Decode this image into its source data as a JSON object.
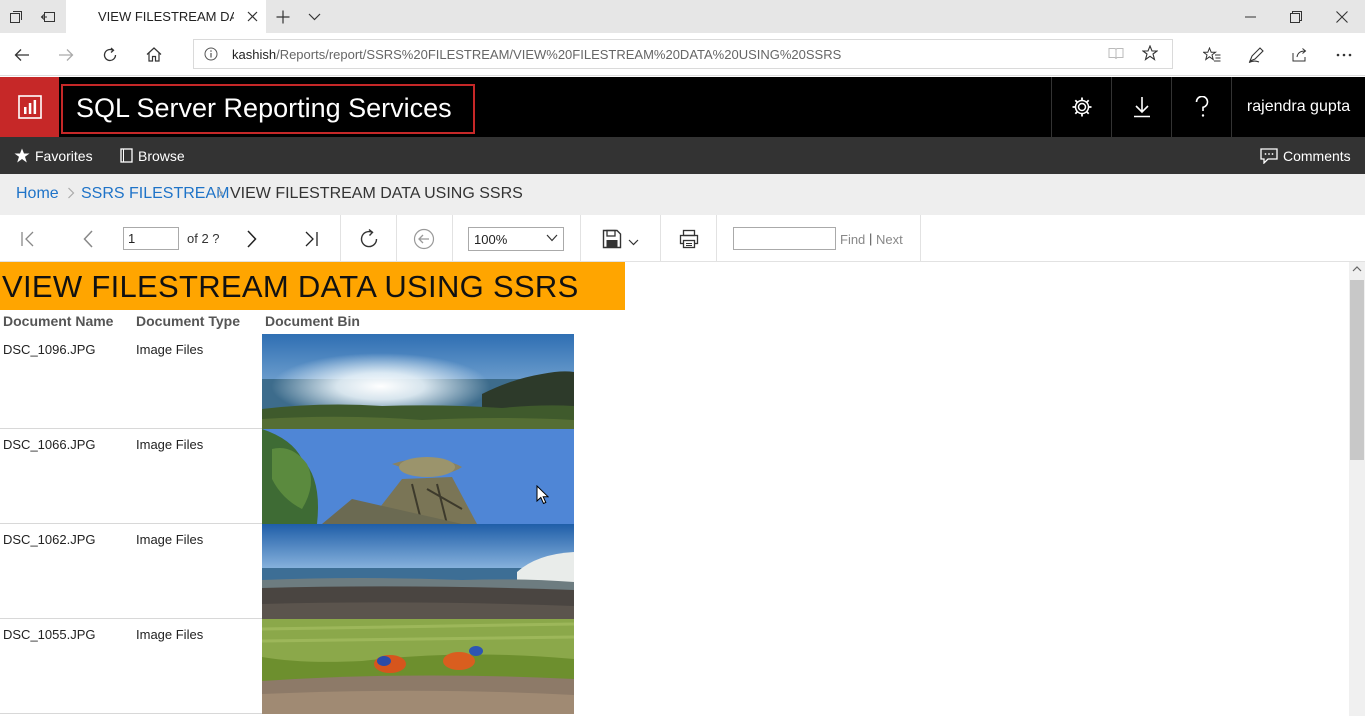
{
  "browser": {
    "tab_title": "VIEW FILESTREAM DATA",
    "url_host": "kashish",
    "url_path": "/Reports/report/SSRS%20FILESTREAM/VIEW%20FILESTREAM%20DATA%20USING%20SSRS"
  },
  "header": {
    "app_title": "SQL Server Reporting Services",
    "user": "rajendra gupta"
  },
  "subnav": {
    "favorites": "Favorites",
    "browse": "Browse",
    "comments": "Comments"
  },
  "breadcrumb": {
    "home": "Home",
    "folder": "SSRS FILESTREAM",
    "current": "VIEW FILESTREAM DATA USING SSRS"
  },
  "toolbar": {
    "page_value": "1",
    "of_pages": "of 2 ?",
    "zoom": "100%",
    "find_label": "Find",
    "find_sep": "|",
    "next_label": "Next"
  },
  "report": {
    "title": "VIEW FILESTREAM DATA USING SSRS",
    "columns": [
      "Document Name",
      "Document Type",
      "Document Bin"
    ],
    "rows": [
      {
        "name": "DSC_1096.JPG",
        "type": "Image Files"
      },
      {
        "name": "DSC_1066.JPG",
        "type": "Image Files"
      },
      {
        "name": "DSC_1062.JPG",
        "type": "Image Files"
      },
      {
        "name": "DSC_1055.JPG",
        "type": "Image Files"
      }
    ]
  },
  "colors": {
    "title_band": "#ffa500",
    "logo_red": "#c62828",
    "link_blue": "#1e73c8"
  }
}
